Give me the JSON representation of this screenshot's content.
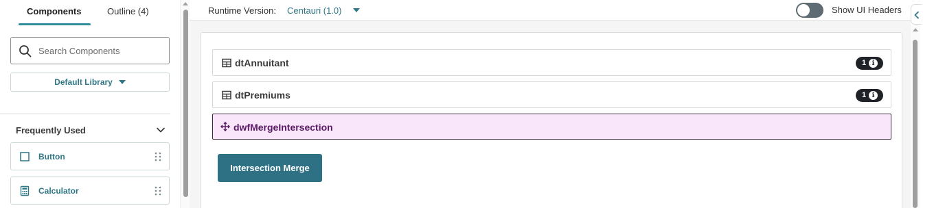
{
  "left_panel": {
    "tabs": [
      {
        "label": "Components",
        "active": true
      },
      {
        "label": "Outline (4)",
        "active": false
      }
    ],
    "search": {
      "placeholder": "Search Components",
      "icon": "search-icon"
    },
    "library": {
      "label": "Default Library",
      "icon": "caret-down-icon"
    },
    "section": {
      "title": "Frequently Used",
      "icon": "chevron-down-icon"
    },
    "components": [
      {
        "label": "Button",
        "icon": "square-icon"
      },
      {
        "label": "Calculator",
        "icon": "calculator-icon"
      }
    ]
  },
  "topbar": {
    "runtime_label": "Runtime Version:",
    "runtime_value": "Centauri (1.0)",
    "toggle_label": "Show UI Headers",
    "toggle_on": false
  },
  "canvas": {
    "rows": [
      {
        "label": "dtAnnuitant",
        "icon": "table-icon",
        "badge": "1"
      },
      {
        "label": "dtPremiums",
        "icon": "table-icon",
        "badge": "1"
      },
      {
        "label": "dwfMergeIntersection",
        "icon": "move-icon",
        "selected": true
      }
    ],
    "button_label": "Intersection Merge"
  },
  "colors": {
    "accent": "#2e8d9a",
    "primary_button": "#2e7185",
    "selected_bg": "#fae6fb",
    "badge_bg": "#1f2227"
  }
}
